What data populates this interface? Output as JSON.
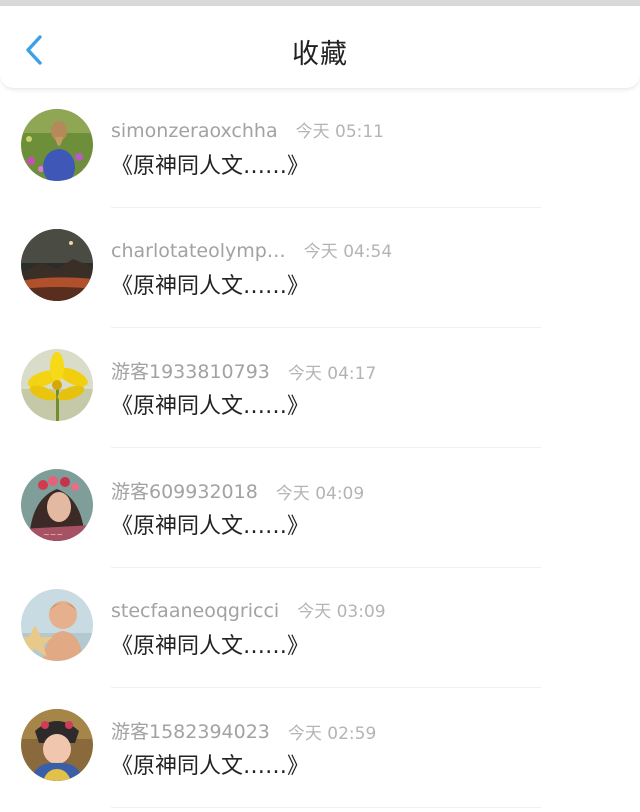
{
  "header": {
    "title": "收藏",
    "back_icon": "chevron-left-icon",
    "accent_color": "#3aa0e8"
  },
  "favorites": [
    {
      "username": "simonzeraoxchha",
      "time": "今天 05:11",
      "content": "《原神同人文……》",
      "avatar": "girl-in-flower-field"
    },
    {
      "username": "charlotateolymp…",
      "time": "今天 04:54",
      "content": "《原神同人文……》",
      "avatar": "dark-sunset-landscape"
    },
    {
      "username": "游客1933810793",
      "time": "今天 04:17",
      "content": "《原神同人文……》",
      "avatar": "yellow-flower"
    },
    {
      "username": "游客609932018",
      "time": "今天 04:09",
      "content": "《原神同人文……》",
      "avatar": "woman-with-flower-crown"
    },
    {
      "username": "stecfaaneoqgricci",
      "time": "今天 03:09",
      "content": "《原神同人文……》",
      "avatar": "child-with-starfish"
    },
    {
      "username": "游客1582394023",
      "time": "今天 02:59",
      "content": "《原神同人文……》",
      "avatar": "costumed-girl"
    }
  ]
}
